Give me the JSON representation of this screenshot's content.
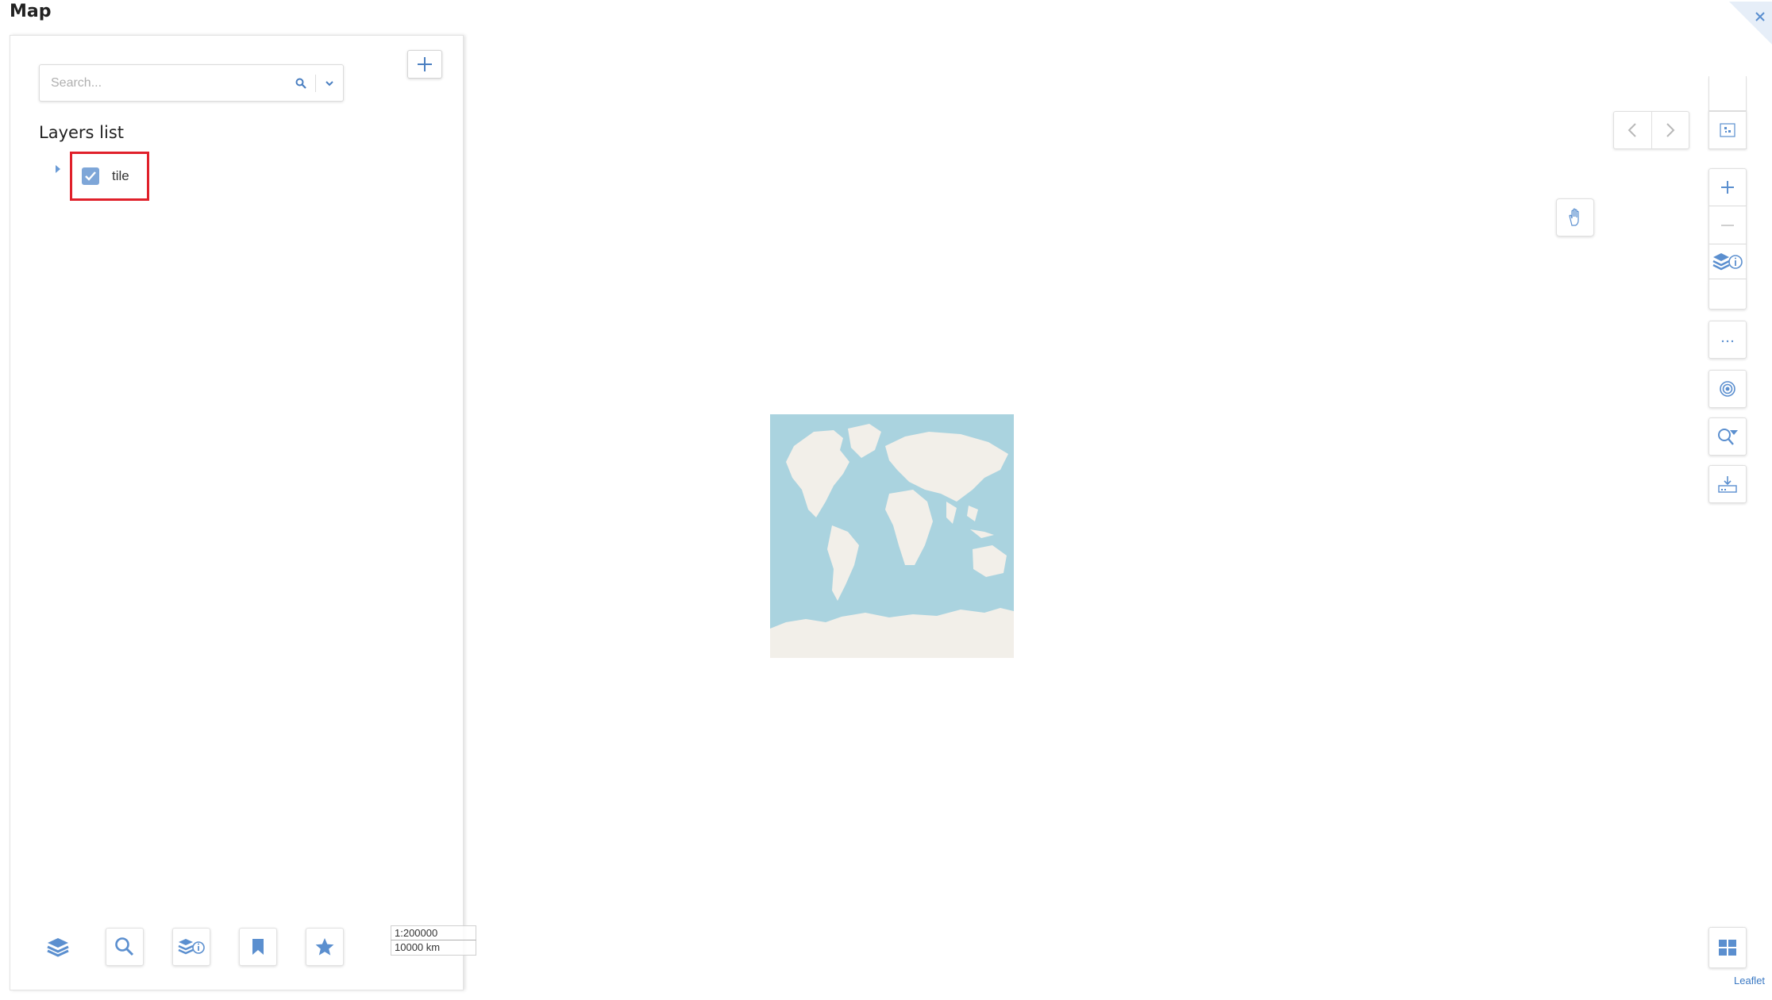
{
  "app": {
    "title": "Map"
  },
  "search": {
    "placeholder": "Search..."
  },
  "layers": {
    "title": "Layers list",
    "items": [
      {
        "label": "tile",
        "checked": true
      }
    ]
  },
  "scale": {
    "ratio": "1:200000",
    "distance": "10000 km"
  },
  "attribution": {
    "label": "Leaflet"
  },
  "bottom_toolbar": [
    "layers-icon",
    "search-icon",
    "layer-info-icon",
    "bookmark-icon",
    "star-icon"
  ],
  "right_toolbar": [
    "qr-icon",
    "zoom-in-icon",
    "zoom-out-icon",
    "layer-info-icon",
    "more-icon",
    "locate-icon",
    "search-filter-icon",
    "download-icon",
    "grid-icon"
  ],
  "colors": {
    "accent": "#5b8fcf",
    "highlight": "#e0202a",
    "water": "#aad3df",
    "land": "#f2efe9"
  }
}
